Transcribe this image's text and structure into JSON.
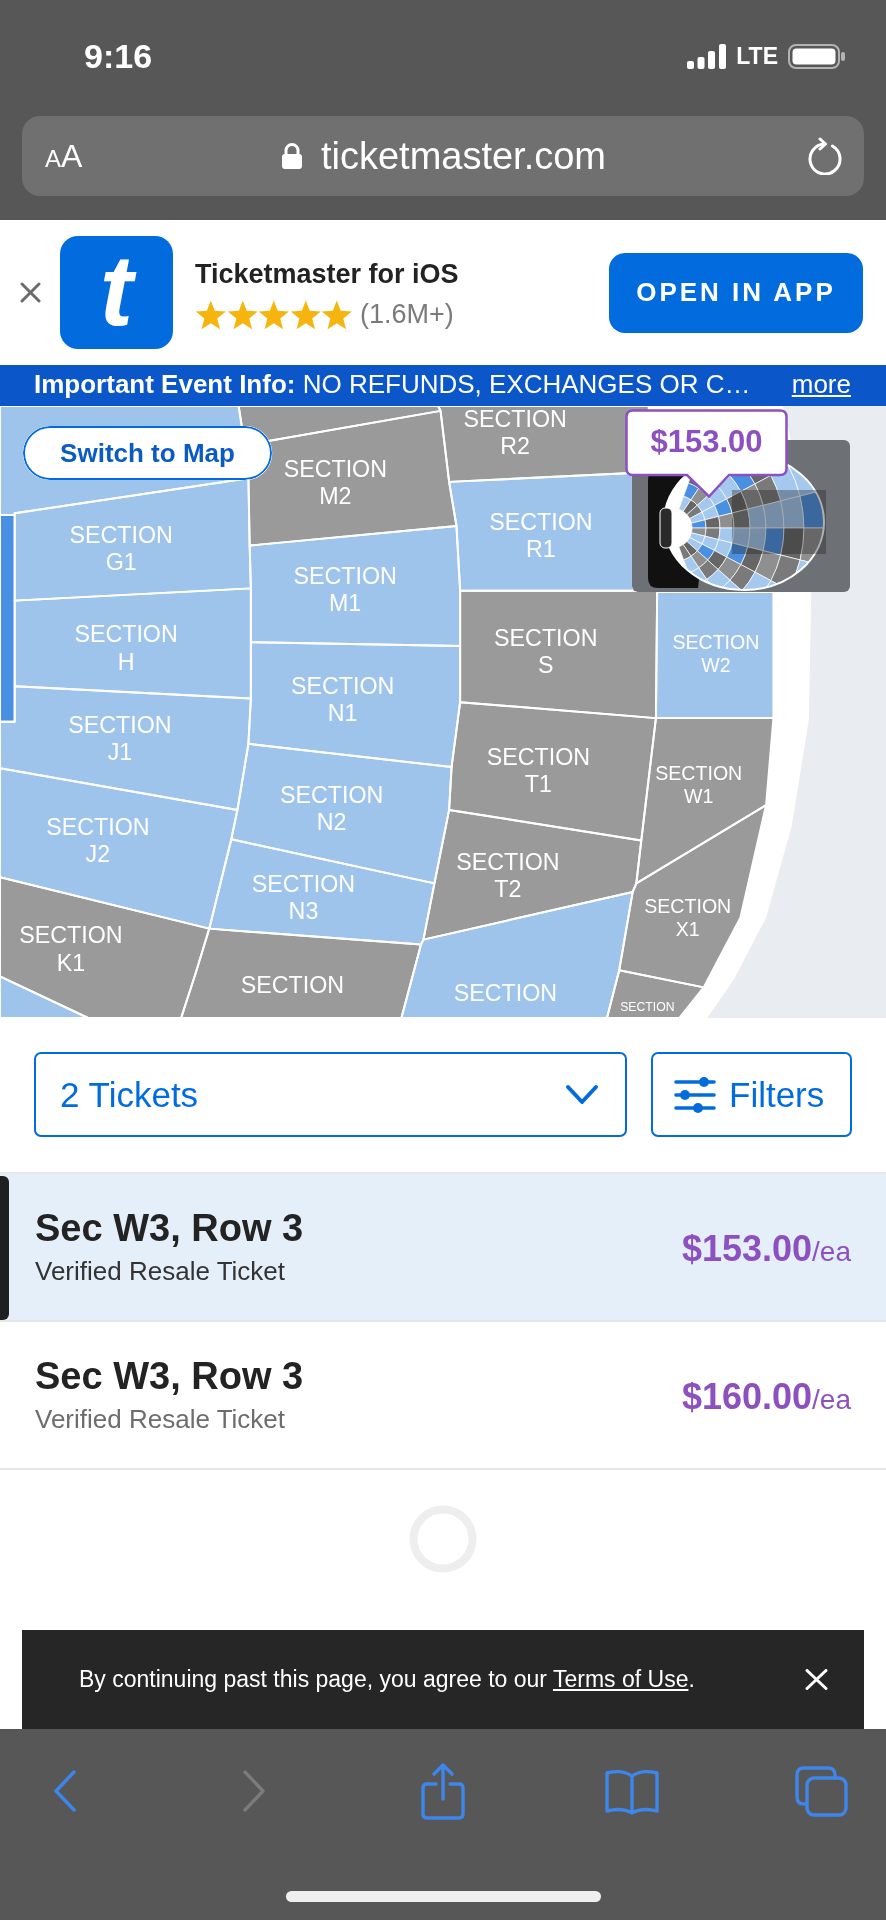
{
  "status_bar": {
    "time": "9:16",
    "network": "LTE"
  },
  "browser": {
    "text_size_label": "AA",
    "url": "ticketmaster.com"
  },
  "app_banner": {
    "icon_letter": "t",
    "title": "Ticketmaster for iOS",
    "stars": 5,
    "rating_count": "(1.6M+)",
    "button": "OPEN IN APP"
  },
  "info_bar": {
    "text": "**Important Event Info:** NO REFUNDS, EXCHANGES OR C…",
    "link": "more"
  },
  "seat_map": {
    "switch_button": "Switch to Map",
    "price_tooltip": "$153.00",
    "sections": [
      {
        "available": true,
        "selected": false
      },
      {
        "available": true,
        "selected": true
      },
      {
        "label": "SECTION G1",
        "available": true,
        "selected": false
      },
      {
        "label": "SECTION H",
        "available": true,
        "selected": false
      },
      {
        "label": "SECTION J1",
        "available": true,
        "selected": false
      },
      {
        "label": "SECTION J2",
        "available": true,
        "selected": false
      },
      {
        "label": "SECTION K1",
        "available": false,
        "selected": false
      },
      {
        "available": true,
        "selected": false
      },
      {
        "available": false,
        "selected": false
      },
      {
        "label": "SECTION M2",
        "available": false,
        "selected": false
      },
      {
        "label": "SECTION M1",
        "available": true,
        "selected": false
      },
      {
        "label": "SECTION N1",
        "available": true,
        "selected": false
      },
      {
        "label": "SECTION N2",
        "available": true,
        "selected": false
      },
      {
        "label": "SECTION N3",
        "available": true,
        "selected": false
      },
      {
        "label": "SECTION",
        "available": false,
        "selected": false
      },
      {
        "label": "SECTION R2",
        "available": false,
        "selected": false
      },
      {
        "label": "SECTION R1",
        "available": true,
        "selected": false
      },
      {
        "label": "SECTION S",
        "available": false,
        "selected": false
      },
      {
        "label": "SECTION T1",
        "available": false,
        "selected": false
      },
      {
        "label": "SECTION T2",
        "available": false,
        "selected": false
      },
      {
        "label": "SECTION",
        "available": true,
        "selected": false
      },
      {
        "label": "SECTION W2",
        "available": true,
        "selected": false
      },
      {
        "label": "SECTION W1",
        "available": false,
        "selected": false
      },
      {
        "label": "SECTION X1",
        "available": false,
        "selected": false
      },
      {
        "label": "SECTION",
        "available": false,
        "selected": false
      }
    ]
  },
  "ticket_controls": {
    "quantity": "2 Tickets",
    "filters": "Filters"
  },
  "listings": [
    {
      "title": "Sec W3, Row 3",
      "subtitle": "Verified Resale Ticket",
      "price": "$153.00",
      "unit": "/ea",
      "selected": true
    },
    {
      "title": "Sec W3, Row 3",
      "subtitle": "Verified Resale Ticket",
      "price": "$160.00",
      "unit": "/ea",
      "selected": false
    }
  ],
  "loading": true,
  "cookie_notice": {
    "before": "By continuing past this page, you agree to our ",
    "link": "Terms of Use",
    "after": "."
  },
  "toolbar": [
    {
      "kind": "back",
      "disabled": false
    },
    {
      "kind": "forward",
      "disabled": true
    },
    {
      "kind": "share",
      "disabled": false
    },
    {
      "kind": "bookmarks",
      "disabled": false
    },
    {
      "kind": "tabs",
      "disabled": false
    }
  ]
}
